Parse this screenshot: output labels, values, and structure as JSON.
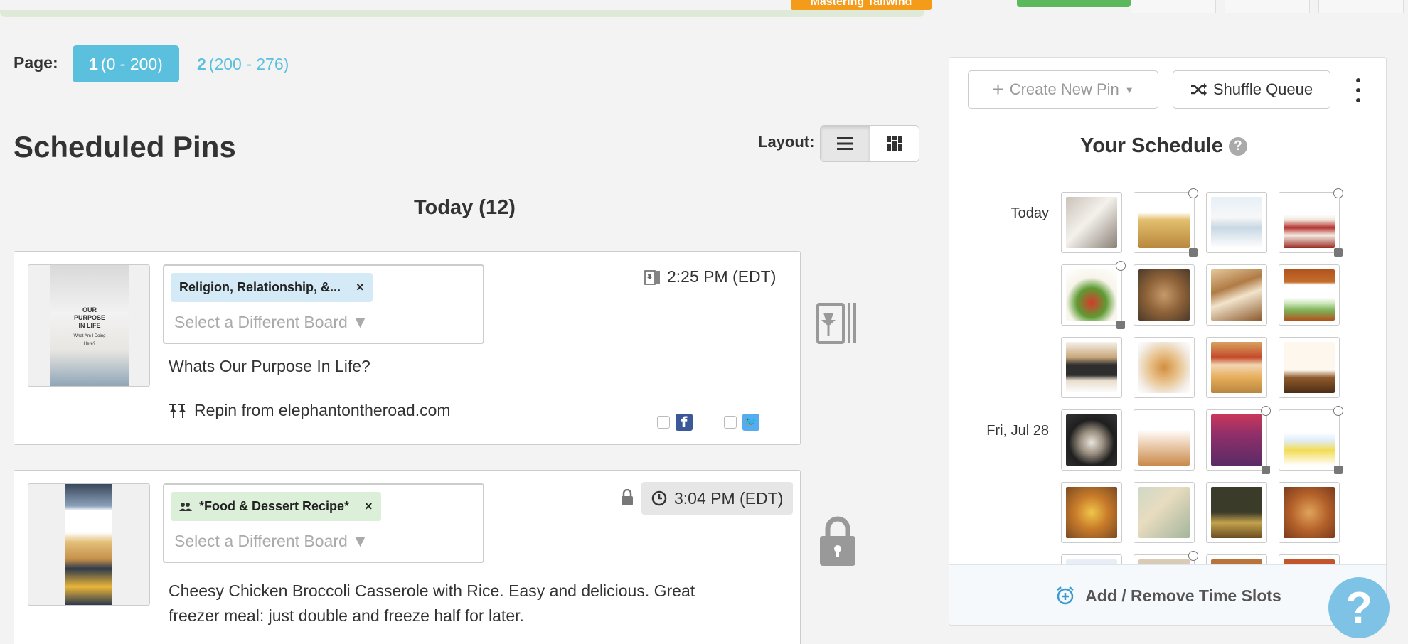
{
  "topbar": {
    "badge": "Mastering Tailwind"
  },
  "pagination": {
    "label": "Page:",
    "pages": [
      {
        "num": "1",
        "range": "(0 - 200)"
      },
      {
        "num": "2",
        "range": "(200 - 276)"
      }
    ]
  },
  "main": {
    "title": "Scheduled Pins",
    "layout_label": "Layout:",
    "day_heading": "Today (12)"
  },
  "pins": [
    {
      "board": "Religion, Relationship, &...",
      "board_remove": "×",
      "board_placeholder": "Select a Different Board ▼",
      "time": "2:25 PM (EDT)",
      "description": "Whats Our Purpose In Life?",
      "source": "Repin from elephantontheroad.com",
      "thumb_text": [
        "OUR",
        "PURPOSE",
        "IN LIFE",
        "What Am I Doing Here?"
      ]
    },
    {
      "board": "*Food & Dessert Recipe*",
      "board_remove": "×",
      "board_placeholder": "Select a Different Board ▼",
      "time": "3:04 PM (EDT)",
      "description_line1": "Cheesy Chicken Broccoli Casserole with Rice. Easy and delicious. Great",
      "description_line2": "freezer meal: just double and freeze half for later."
    }
  ],
  "panel": {
    "create_label": "Create New Pin",
    "shuffle_label": "Shuffle Queue",
    "schedule_title": "Your Schedule",
    "help_mark": "?",
    "rows": [
      {
        "label": "Today"
      },
      {
        "label": "Fri, Jul 28"
      }
    ],
    "footer_label": "Add / Remove Time Slots"
  },
  "help_fab": "?",
  "colors": {
    "accent": "#5bc0de",
    "facebook": "#3b5998",
    "twitter": "#55acee"
  }
}
